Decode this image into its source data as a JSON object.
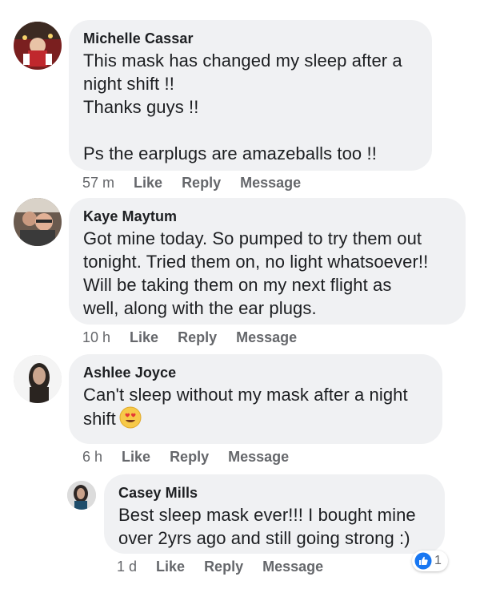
{
  "colors": {
    "bubble": "#f0f1f3",
    "meta_text": "#65676b",
    "like_blue": "#1877f2",
    "text": "#1c1e21"
  },
  "comments": [
    {
      "author": "Michelle Cassar",
      "text": "This mask has changed my sleep after a\nnight shift !!\nThanks guys !!\n\nPs the earplugs are amazeballs too !!",
      "time": "57 m",
      "like": "Like",
      "reply": "Reply",
      "message": "Message",
      "avatar_icon": "christmas-photo-avatar"
    },
    {
      "author": "Kaye Maytum",
      "text": "Got mine today. So pumped to try them out\ntonight. Tried them on, no light whatsoever!!\nWill be taking them on my next flight as\nwell, along with the ear plugs.",
      "time": "10 h",
      "like": "Like",
      "reply": "Reply",
      "message": "Message",
      "avatar_icon": "selfie-avatar"
    },
    {
      "author": "Ashlee Joyce",
      "text": "Can't sleep without my mask after a night\nshift",
      "emoji": "heart-eyes-emoji",
      "time": "6 h",
      "like": "Like",
      "reply": "Reply",
      "message": "Message",
      "avatar_icon": "portrait-avatar"
    }
  ],
  "reply": {
    "author": "Casey Mills",
    "text": "Best sleep mask ever!!! I bought mine\nover 2yrs ago and still going strong :)",
    "time": "1 d",
    "like": "Like",
    "reply": "Reply",
    "message": "Message",
    "avatar_icon": "portrait-avatar",
    "reaction_icon": "thumbs-up-icon",
    "reaction_count": "1"
  }
}
